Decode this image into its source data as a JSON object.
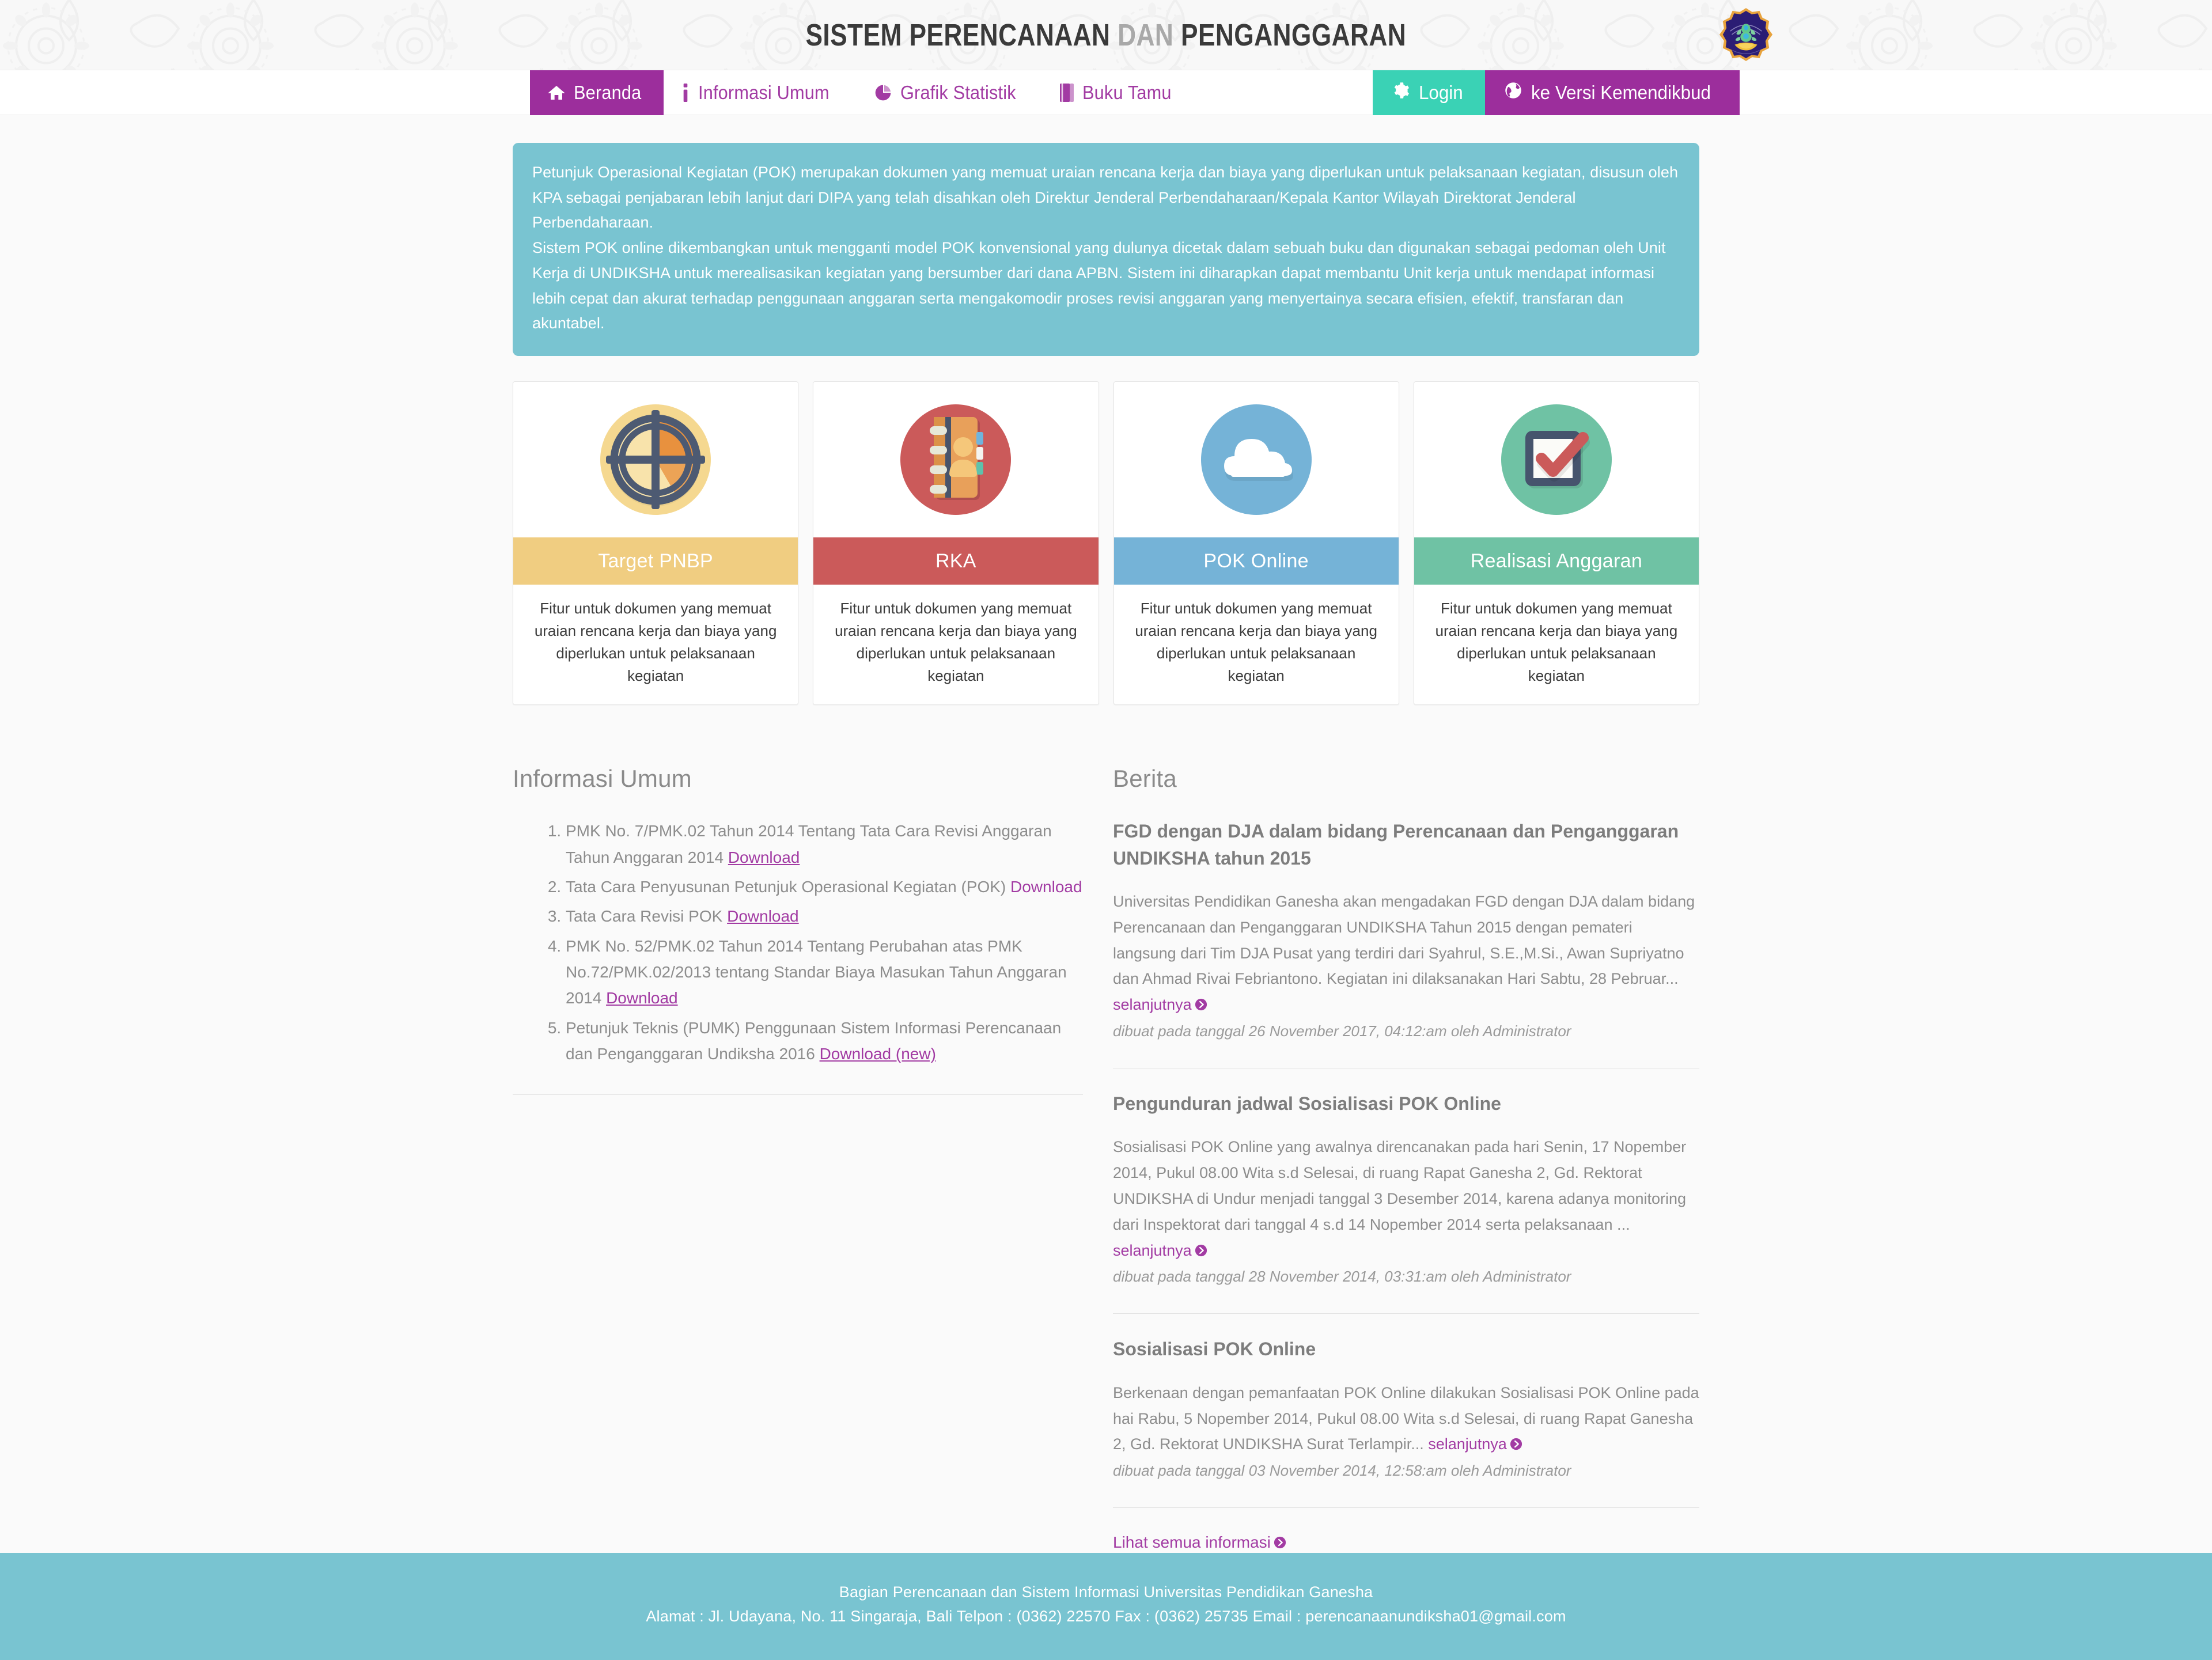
{
  "header": {
    "title_part1": "Sistem Perencanaan",
    "title_dim": "dan",
    "title_part2": "Penganggaran",
    "logo_name": "undiksha-ganesha-logo"
  },
  "nav": {
    "items": [
      {
        "label": "Beranda",
        "icon": "home-icon",
        "active": true
      },
      {
        "label": "Informasi Umum",
        "icon": "info-icon",
        "active": false
      },
      {
        "label": "Grafik Statistik",
        "icon": "pie-chart-icon",
        "active": false
      },
      {
        "label": "Buku Tamu",
        "icon": "book-icon",
        "active": false
      }
    ],
    "login": {
      "label": "Login",
      "icon": "gear-icon",
      "color": "#3ad2b5"
    },
    "kemdikbud": {
      "label": "ke Versi Kemendikbud",
      "icon": "globe-icon",
      "color": "#9c2e9c"
    }
  },
  "banner": {
    "color": "#79c4d1",
    "paragraph1": "Petunjuk Operasional Kegiatan (POK) merupakan dokumen yang memuat uraian rencana kerja dan biaya yang diperlukan untuk pelaksanaan kegiatan, disusun oleh KPA sebagai penjabaran lebih lanjut dari DIPA yang telah disahkan oleh Direktur Jenderal Perbendaharaan/Kepala Kantor Wilayah Direktorat Jenderal Perbendaharaan.",
    "paragraph2": "Sistem POK online dikembangkan untuk mengganti model POK konvensional yang dulunya dicetak dalam sebuah buku dan digunakan sebagai pedoman oleh Unit Kerja di UNDIKSHA untuk merealisasikan kegiatan yang bersumber dari dana APBN.  Sistem ini diharapkan dapat membantu Unit kerja untuk mendapat informasi lebih cepat dan akurat terhadap penggunaan anggaran serta mengakomodir proses revisi anggaran yang menyertainya secara efisien, efektif, transfaran dan akuntabel."
  },
  "cards": [
    {
      "title": "Target PNBP",
      "color": "#f0cd81",
      "icon": "target-pie-icon",
      "desc": "Fitur untuk dokumen yang memuat uraian rencana kerja dan biaya yang diperlukan untuk pelaksanaan kegiatan"
    },
    {
      "title": "RKA",
      "color": "#cb5a5a",
      "icon": "address-book-icon",
      "desc": "Fitur untuk dokumen yang memuat uraian rencana kerja dan biaya yang diperlukan untuk pelaksanaan kegiatan"
    },
    {
      "title": "POK Online",
      "color": "#75b3d7",
      "icon": "cloud-icon",
      "desc": "Fitur untuk dokumen yang memuat uraian rencana kerja dan biaya yang diperlukan untuk pelaksanaan kegiatan"
    },
    {
      "title": "Realisasi Anggaran",
      "color": "#6fc2a4",
      "icon": "checkbox-check-icon",
      "desc": "Fitur untuk dokumen yang memuat uraian rencana kerja dan biaya yang diperlukan untuk pelaksanaan kegiatan"
    }
  ],
  "info_section": {
    "heading": "Informasi Umum",
    "items": [
      {
        "text": "PMK No. 7/PMK.02 Tahun 2014 Tentang Tata Cara Revisi Anggaran Tahun Anggaran 2014 ",
        "link": "Download",
        "underline": true
      },
      {
        "text": "Tata Cara Penyusunan Petunjuk Operasional Kegiatan (POK) ",
        "link": "Download",
        "underline": false
      },
      {
        "text": "Tata Cara Revisi POK ",
        "link": "Download",
        "underline": true
      },
      {
        "text": "PMK No. 52/PMK.02 Tahun 2014 Tentang Perubahan atas PMK No.72/PMK.02/2013 tentang Standar Biaya Masukan Tahun Anggaran 2014 ",
        "link": "Download",
        "underline": true
      },
      {
        "text": "Petunjuk Teknis (PUMK) Penggunaan Sistem Informasi Perencanaan dan Penganggaran Undiksha 2016 ",
        "link": "Download (new)",
        "underline": true
      }
    ]
  },
  "news_section": {
    "heading": "Berita",
    "more_label": "selanjutnya",
    "see_all_label": "Lihat semua informasi",
    "items": [
      {
        "title": "FGD dengan DJA dalam bidang Perencanaan dan Penganggaran UNDIKSHA tahun 2015",
        "body": "Universitas Pendidikan Ganesha akan mengadakan FGD dengan DJA dalam bidang Perencanaan dan Penganggaran UNDIKSHA Tahun 2015 dengan pemateri langsung dari Tim DJA Pusat yang terdiri dari Syahrul, S.E.,M.Si., Awan Supriyatno dan Ahmad Rivai Febriantono. Kegiatan ini dilaksanakan Hari Sabtu, 28 Pebruar... ",
        "meta": "dibuat pada tanggal 26 November 2017, 04:12:am oleh Administrator"
      },
      {
        "title": "Pengunduran jadwal Sosialisasi POK Online",
        "body": "Sosialisasi POK Online yang awalnya direncanakan pada hari Senin, 17 Nopember 2014, Pukul 08.00 Wita s.d Selesai, di ruang Rapat Ganesha 2, Gd. Rektorat UNDIKSHA di Undur menjadi tanggal 3 Desember 2014, karena adanya monitoring dari Inspektorat dari tanggal 4 s.d 14 Nopember 2014 serta pelaksanaan ... ",
        "meta": "dibuat pada tanggal 28 November 2014, 03:31:am oleh Administrator"
      },
      {
        "title": "Sosialisasi POK Online",
        "body": "Berkenaan dengan pemanfaatan POK Online dilakukan Sosialisasi POK Online pada hai Rabu, 5 Nopember 2014, Pukul 08.00 Wita s.d Selesai, di ruang Rapat Ganesha 2, Gd. Rektorat UNDIKSHA Surat Terlampir... ",
        "meta": "dibuat pada tanggal 03 November 2014, 12:58:am oleh Administrator"
      }
    ]
  },
  "footer": {
    "color": "#79c4d1",
    "line1": "Bagian Perencanaan dan Sistem Informasi Universitas Pendidikan Ganesha",
    "line2": "Alamat : Jl. Udayana, No. 11 Singaraja, Bali Telpon : (0362) 22570 Fax : (0362) 25735 Email : perencanaanundiksha01@gmail.com"
  }
}
